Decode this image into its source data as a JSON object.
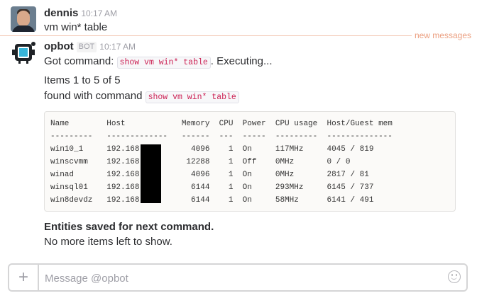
{
  "messages": [
    {
      "user": "dennis",
      "time": "10:17 AM",
      "text": "vm win* table"
    },
    {
      "user": "opbot",
      "badge": "BOT",
      "time": "10:17 AM",
      "line1_prefix": "Got command:",
      "line1_code": "show vm win* table",
      "line1_suffix": ". Executing...",
      "items_line": "Items 1 to 5 of 5",
      "found_prefix": "found with command",
      "found_code": "show vm win* table",
      "entities_saved": "Entities saved for next command.",
      "no_more": "No more items left to show."
    }
  ],
  "new_messages_label": "new messages",
  "table": {
    "header": "Name        Host            Memory  CPU  Power  CPU usage  Host/Guest mem",
    "separator": "---------   -------------   ------  ---  -----  ---------  --------------",
    "rows": [
      "win10_1     192.168.          4096    1  On     117MHz     4045 / 819",
      "winscvmm    192.168.         12288    1  Off    0MHz       0 / 0",
      "winad       192.168.          4096    1  On     0MHz       2817 / 81",
      "winsql01    192.168.          6144    1  On     293MHz     6145 / 737",
      "win8devdz   192.168.          6144    1  On     58MHz      6141 / 491"
    ]
  },
  "composer": {
    "placeholder": "Message @opbot",
    "plus_label": "+"
  },
  "icons": {
    "plus": "plus-icon",
    "emoji": "emoji-icon",
    "bot_avatar": "bot-avatar-icon"
  }
}
